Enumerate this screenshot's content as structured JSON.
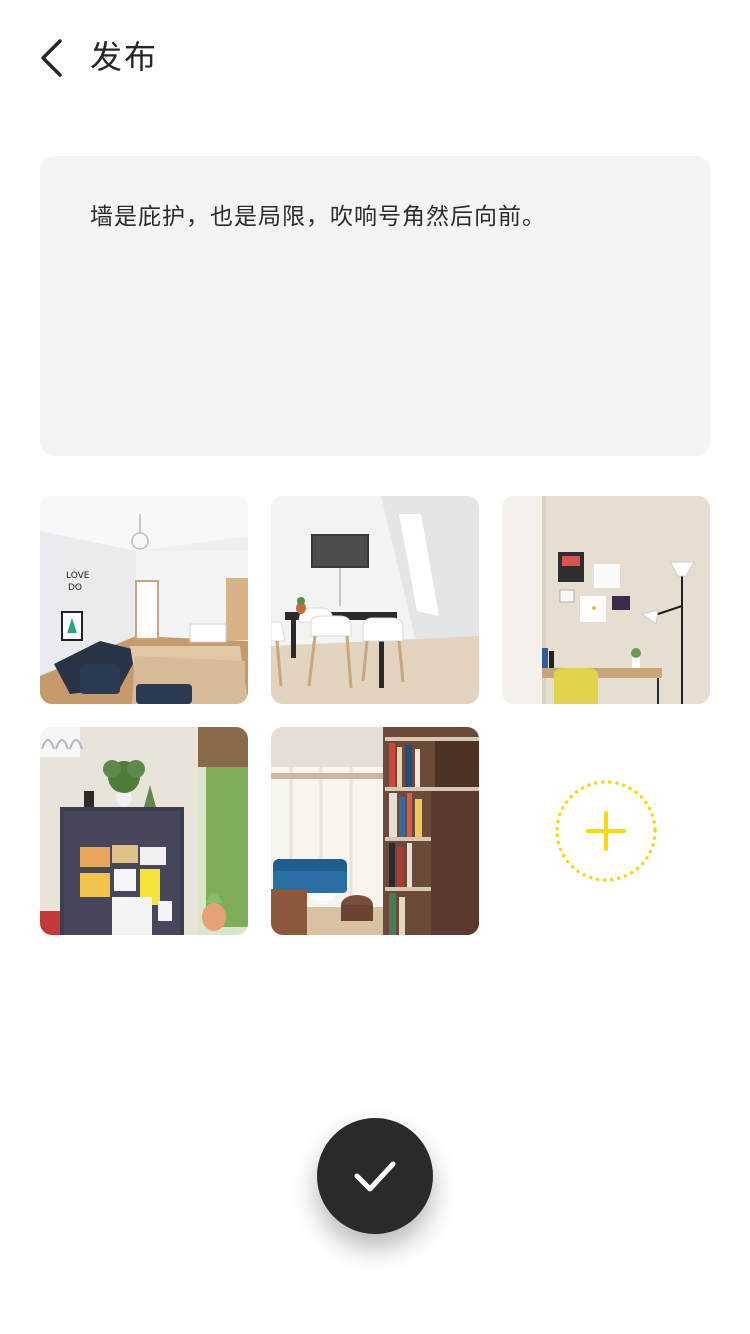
{
  "header": {
    "title": "发布",
    "back_icon": "chevron-left-icon"
  },
  "post": {
    "text": "墙是庇护，也是局限，吹响号角然后向前。"
  },
  "photos": [
    {
      "name": "bedroom-photo"
    },
    {
      "name": "dining-room-photo"
    },
    {
      "name": "desk-corner-photo"
    },
    {
      "name": "locker-photo"
    },
    {
      "name": "bookshelf-living-room-photo"
    }
  ],
  "add_photo": {
    "icon": "plus-icon",
    "accent": "#f5d90a"
  },
  "confirm": {
    "icon": "checkmark-icon"
  },
  "colors": {
    "text_box_bg": "#f4f4f4",
    "confirm_bg": "#2a2a2a",
    "accent_yellow": "#f5d90a"
  }
}
